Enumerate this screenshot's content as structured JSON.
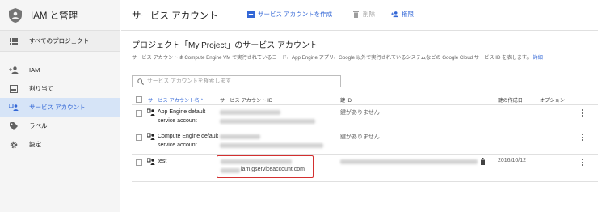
{
  "sidebar": {
    "title": "IAM と管理",
    "project": "すべてのプロジェクト",
    "items": [
      {
        "label": "IAM",
        "icon": "person-add-icon"
      },
      {
        "label": "割り当て",
        "icon": "dashboard-icon"
      },
      {
        "label": "サービス アカウント",
        "icon": "service-account-icon",
        "active": true
      },
      {
        "label": "ラベル",
        "icon": "label-icon"
      },
      {
        "label": "設定",
        "icon": "gear-icon"
      }
    ]
  },
  "header": {
    "title": "サービス アカウント",
    "create_label": "サービス アカウントを作成",
    "delete_label": "削除",
    "permission_label": "権限"
  },
  "main": {
    "title": "プロジェクト「My Project」のサービス アカウント",
    "description": "サービス アカウントは Compute Engine VM で実行されているコード、App Engine アプリ、Google 以外で実行されているシステムなどの Google Cloud サービス ID を表します。",
    "details_link": "詳細",
    "search_placeholder": "サービス アカウントを検索します"
  },
  "table": {
    "columns": {
      "name": "サービス アカウント名 ^",
      "id": "サービス アカウント ID",
      "key_id": "鍵 ID",
      "created": "鍵の作成日",
      "options": "オプション"
    },
    "rows": [
      {
        "name": "App Engine default service account",
        "key_id": "鍵がありません",
        "created": ""
      },
      {
        "name": "Compute Engine default service account",
        "key_id": "鍵がありません",
        "created": ""
      },
      {
        "name": "test",
        "key_id": "",
        "created": "2016/10/12",
        "email_suffix": "iam.gserviceaccount.com"
      }
    ]
  },
  "colors": {
    "accent": "#3367d6",
    "highlight": "#d32f2f",
    "active_bg": "#d6e4f7"
  }
}
